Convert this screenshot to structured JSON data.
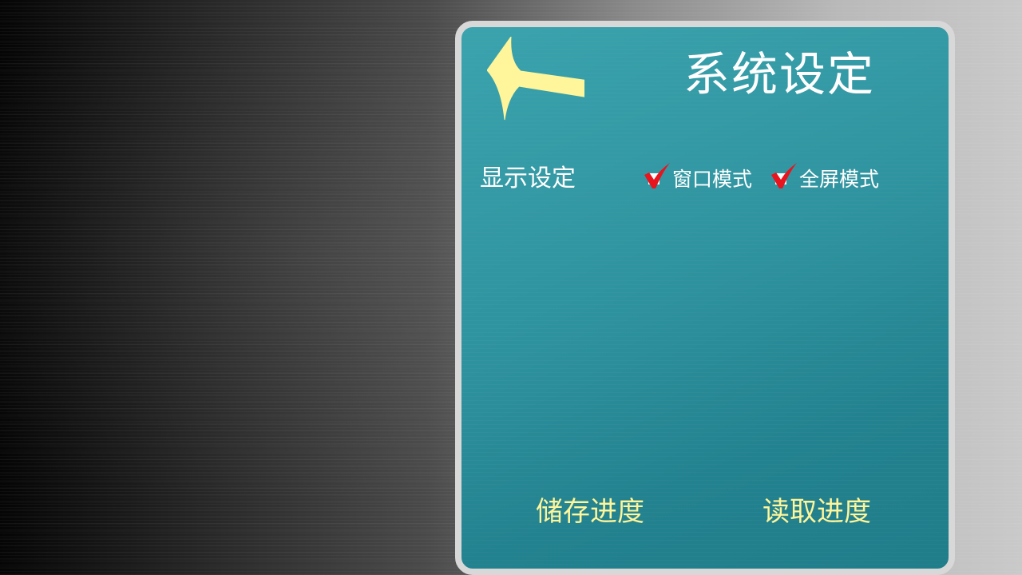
{
  "screen": {
    "title": "系统设定",
    "back_button": {
      "icon": "arrow-left-icon",
      "color": "#fff59a"
    }
  },
  "display_settings": {
    "label": "显示设定",
    "options": [
      {
        "label": "窗口模式",
        "checked": true,
        "icon": "red-checkmark-icon"
      },
      {
        "label": "全屏模式",
        "checked": true,
        "icon": "red-checkmark-icon"
      }
    ]
  },
  "actions": {
    "save_label": "储存进度",
    "load_label": "读取进度"
  },
  "colors": {
    "panel_bg": "#2f939f",
    "panel_border": "#d8d8d8",
    "title_text": "#ffffff",
    "action_text": "#fff59a",
    "checkmark": "#e8141e"
  }
}
